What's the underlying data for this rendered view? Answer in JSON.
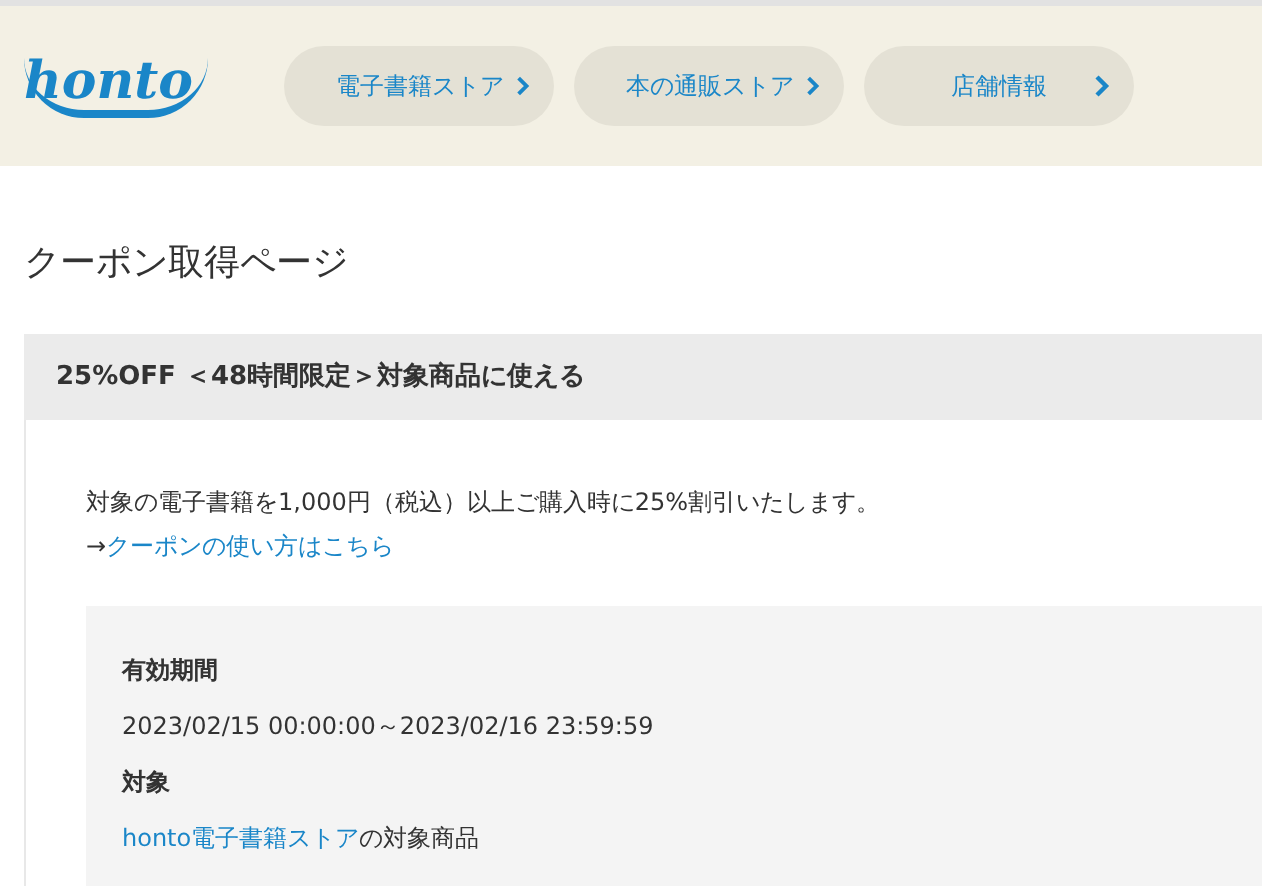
{
  "header": {
    "logo": "honto",
    "nav": [
      {
        "label": "電子書籍ストア"
      },
      {
        "label": "本の通販ストア"
      },
      {
        "label": "店舗情報"
      }
    ]
  },
  "page_title": "クーポン取得ページ",
  "coupon": {
    "title": "25%OFF ＜48時間限定＞対象商品に使える",
    "description": "対象の電子書籍を1,000円（税込）以上ご購入時に25%割引いたします。",
    "usage_prefix": "→",
    "usage_link": "クーポンの使い方はこちら",
    "details": [
      {
        "label": "有効期間",
        "parts": [
          {
            "kind": "text",
            "text": "2023/02/15 00:00:00～2023/02/16 23:59:59"
          }
        ]
      },
      {
        "label": "対象",
        "parts": [
          {
            "kind": "link",
            "text": "honto電子書籍ストア"
          },
          {
            "kind": "text",
            "text": "の対象商品"
          }
        ]
      }
    ]
  }
}
